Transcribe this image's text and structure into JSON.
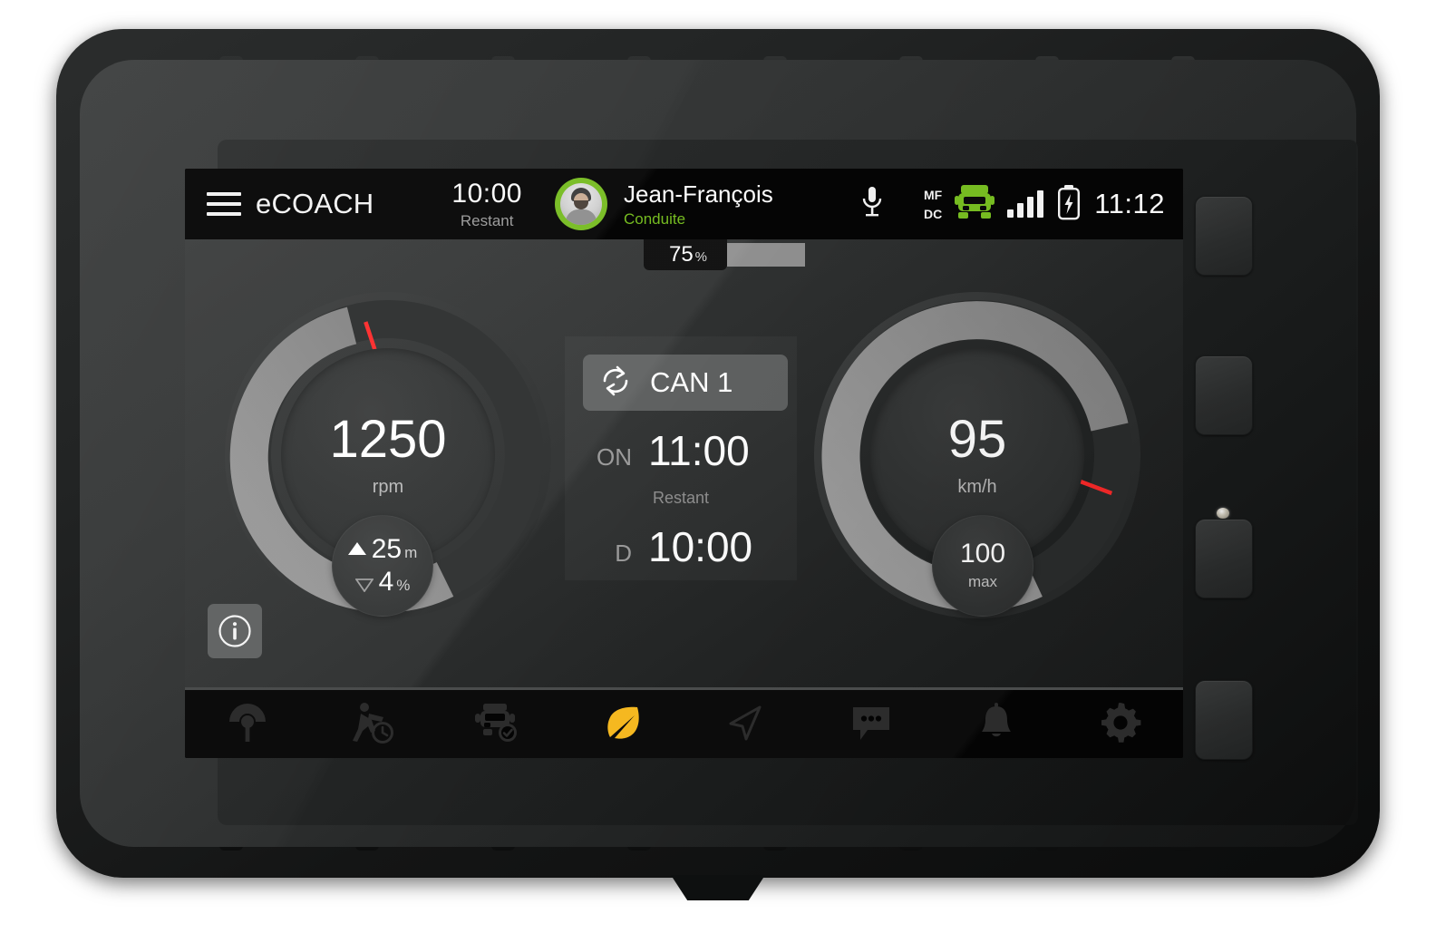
{
  "device": {
    "hardware_buttons": 4,
    "led_indicator": "status-led"
  },
  "statusbar": {
    "menu_icon": "hamburger-menu-icon",
    "brand": "eCOACH",
    "timer": {
      "value": "10:00",
      "label": "Restant"
    },
    "avatar_icon": "driver-avatar",
    "driver": {
      "name": "Jean-François",
      "status": "Conduite",
      "status_color": "#76bc21"
    },
    "mic_icon": "microphone-icon",
    "bus_mode": {
      "top": "MF",
      "bottom": "DC"
    },
    "vehicle_icon": "truck-icon",
    "vehicle_icon_color": "#76bc21",
    "signal_icon": "signal-bars-icon",
    "signal_bars": 4,
    "battery_icon": "battery-charging-icon",
    "clock": "11:12"
  },
  "progress": {
    "value": "75",
    "unit": "%",
    "percent": 75,
    "track_color": "#8f8f8f"
  },
  "gauges": {
    "rpm": {
      "value": "1250",
      "unit": "rpm",
      "arc_fill_percent": 40,
      "arc_color": "#8e8e8e",
      "marker_color": "#ff2a2a",
      "marker_percent": 49,
      "badge": {
        "altitude_value": "25",
        "altitude_unit": "m",
        "altitude_arrow": "up-triangle-icon",
        "slope_value": "4",
        "slope_unit": "%",
        "slope_arrow": "down-triangle-icon"
      }
    },
    "speed": {
      "value": "95",
      "unit": "km/h",
      "arc_fill_percent": 76,
      "arc_color": "#8e8e8e",
      "marker_color": "#ff2a2a",
      "marker_percent": 84,
      "badge": {
        "value": "100",
        "label": "max"
      }
    }
  },
  "center_panel": {
    "can_button": {
      "icon": "sync-refresh-icon",
      "label": "CAN 1"
    },
    "rows": [
      {
        "key": "ON",
        "value": "11:00"
      },
      {
        "key": "D",
        "value": "10:00"
      }
    ],
    "middle_label": "Restant"
  },
  "info_button": {
    "icon": "info-circle-icon"
  },
  "tabbar": {
    "items": [
      {
        "name": "tab-tachograph",
        "icon": "tachograph-icon",
        "active": false
      },
      {
        "name": "tab-activity",
        "icon": "driver-activity-clock-icon",
        "active": false
      },
      {
        "name": "tab-vehicle-check",
        "icon": "truck-check-icon",
        "active": false
      },
      {
        "name": "tab-eco",
        "icon": "leaf-icon",
        "active": true
      },
      {
        "name": "tab-navigation",
        "icon": "navigation-arrow-icon",
        "active": false
      },
      {
        "name": "tab-messages",
        "icon": "chat-bubble-icon",
        "active": false
      },
      {
        "name": "tab-alerts",
        "icon": "bell-icon",
        "active": false
      },
      {
        "name": "tab-settings",
        "icon": "gear-icon",
        "active": false
      }
    ],
    "active_color": "#f5b820",
    "inactive_color": "#2c2c2c"
  }
}
